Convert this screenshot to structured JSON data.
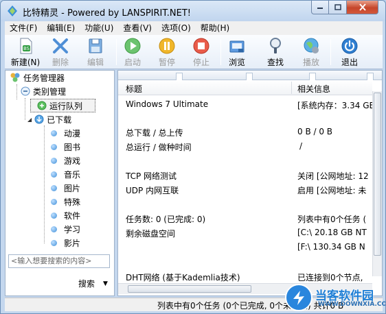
{
  "window": {
    "title": "比特精灵 - Powered by LANSPIRIT.NET!"
  },
  "menu": {
    "items": [
      {
        "label": "文件(F)"
      },
      {
        "label": "编辑(E)"
      },
      {
        "label": "功能(U)"
      },
      {
        "label": "查看(V)"
      },
      {
        "label": "选项(O)"
      },
      {
        "label": "帮助(H)"
      }
    ]
  },
  "toolbar": {
    "new_label": "新建(N)",
    "delete_label": "删除",
    "edit_label": "编辑",
    "start_label": "启动",
    "pause_label": "暂停",
    "stop_label": "停止",
    "browse_label": "浏览",
    "find_label": "查找",
    "play_label": "播放",
    "exit_label": "退出"
  },
  "tree": {
    "root": "任务管理器",
    "category": "类别管理",
    "queue": "运行队列",
    "downloaded": "已下载",
    "children": [
      {
        "label": "动漫"
      },
      {
        "label": "图书"
      },
      {
        "label": "游戏"
      },
      {
        "label": "音乐"
      },
      {
        "label": "图片"
      },
      {
        "label": "特殊"
      },
      {
        "label": "软件"
      },
      {
        "label": "学习"
      },
      {
        "label": "影片"
      }
    ]
  },
  "search": {
    "placeholder": "<输入想要搜索的内容>",
    "button_label": "搜索"
  },
  "info_table": {
    "col_title": "标题",
    "col_info": "相关信息",
    "rows": [
      {
        "key": "Windows 7 Ultimate",
        "value": "[系统内存：3.34 GB"
      },
      {
        "key": "总下载 / 总上传",
        "value": "0 B / 0 B"
      },
      {
        "key": "总运行 / 做种时间",
        "value": "/"
      },
      {
        "key": "TCP 网络测试",
        "value": "关闭 [公网地址: 12"
      },
      {
        "key": "UDP 内网互联",
        "value": "启用 [公网地址: 未"
      },
      {
        "key": "任务数: 0 (已完成: 0)",
        "value": "列表中有0个任务 ("
      },
      {
        "key": "剩余磁盘空间",
        "value": "[C:\\ 20.18 GB  NT"
      },
      {
        "key": "",
        "value": "[F:\\ 130.34 GB  N"
      },
      {
        "key": "DHT网络 (基于Kademlia技术)",
        "value": "已连接到0个节点, "
      }
    ]
  },
  "status": {
    "text": "列表中有0个任务 (0个已完成, 0个未完成)  共计0 B"
  },
  "watermark": {
    "text": "当客软件园",
    "sub": "WWW.DOWNXIA.COM"
  },
  "colors": {
    "accent": "#1f7fd6",
    "close_button": "#c6462a"
  }
}
